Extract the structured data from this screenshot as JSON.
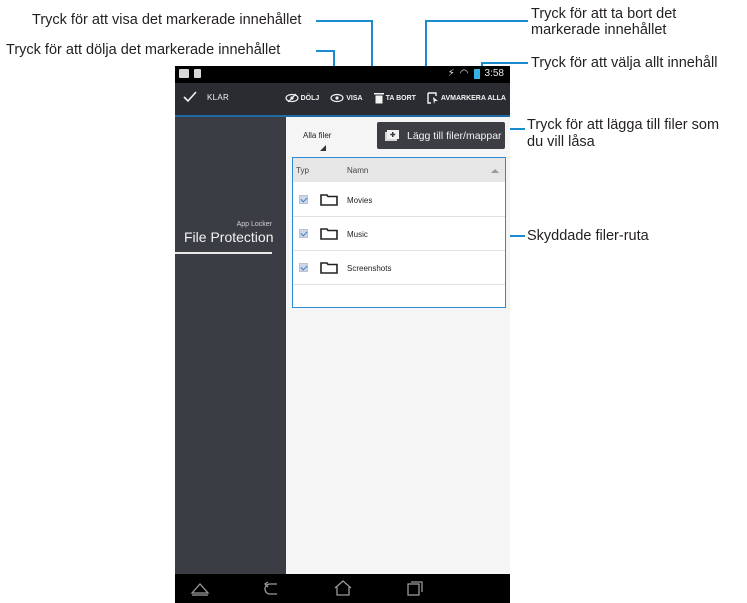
{
  "callouts": {
    "show": "Tryck för att visa det markerade innehållet",
    "hide": "Tryck för att dölja det markerade innehållet",
    "delete_line1": "Tryck för att ta bort det",
    "delete_line2": "markerade innehållet",
    "select_all": "Tryck för att välja allt innehåll",
    "add_line1": "Tryck för att lägga till filer som",
    "add_line2": "du vill låsa",
    "pane": "Skyddade filer-ruta"
  },
  "status_bar": {
    "time": "3:58"
  },
  "action_bar": {
    "done_label": "KLAR",
    "hide_label": "DÖLJ",
    "show_label": "VISA",
    "delete_label": "TA BORT",
    "select_all_label": "AVMARKERA ALLA"
  },
  "sidebar": {
    "subtitle": "App Locker",
    "active_item": "File Protection"
  },
  "content": {
    "filter_value": "Alla filer",
    "add_button_label": "Lägg till filer/mappar",
    "table": {
      "columns": [
        "Typ",
        "Namn"
      ],
      "rows": [
        {
          "name": "Movies",
          "checked": true
        },
        {
          "name": "Music",
          "checked": true
        },
        {
          "name": "Screenshots",
          "checked": true
        }
      ]
    }
  },
  "colors": {
    "accent": "#1b8ccf",
    "action_bar": "#2a2c31",
    "sidebar": "#3b3d44"
  },
  "icons": [
    "check-icon",
    "eye-slash-icon",
    "eye-icon",
    "trash-icon",
    "select-all-icon",
    "add-file-icon",
    "folder-icon",
    "home-icon",
    "back-icon",
    "recent-apps-icon"
  ]
}
